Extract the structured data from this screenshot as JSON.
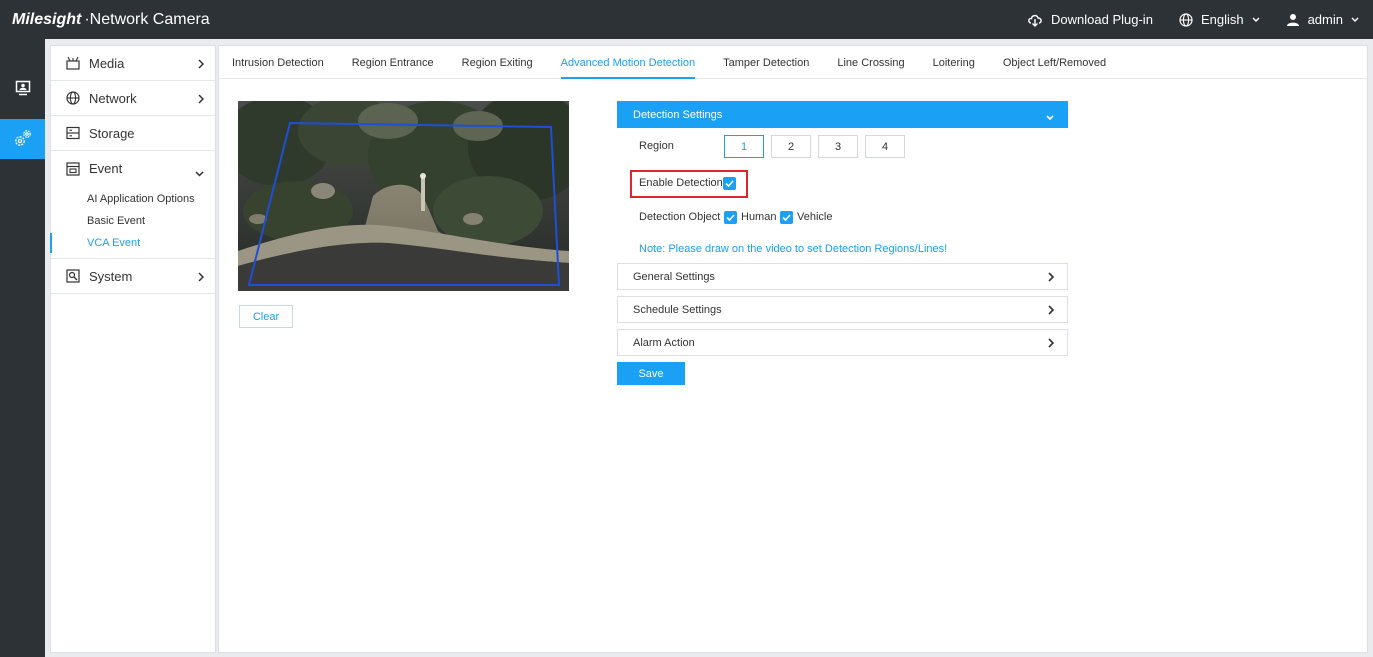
{
  "header": {
    "brand": "Milesight",
    "product": "·Network Camera",
    "download_label": "Download Plug-in",
    "language_label": "English",
    "user_label": "admin"
  },
  "sidebar": {
    "items": [
      {
        "label": "Media"
      },
      {
        "label": "Network"
      },
      {
        "label": "Storage"
      },
      {
        "label": "Event"
      },
      {
        "label": "System"
      }
    ],
    "event_sub": [
      "AI Application Options",
      "Basic Event",
      "VCA Event"
    ]
  },
  "tabs": [
    "Intrusion Detection",
    "Region Entrance",
    "Region Exiting",
    "Advanced Motion Detection",
    "Tamper Detection",
    "Line Crossing",
    "Loitering",
    "Object Left/Removed"
  ],
  "video": {
    "clear_label": "Clear"
  },
  "detection_settings": {
    "title": "Detection Settings",
    "region_label": "Region",
    "regions": [
      "1",
      "2",
      "3",
      "4"
    ],
    "enable_label": "Enable Detection",
    "object_label": "Detection Object",
    "object_human": "Human",
    "object_vehicle": "Vehicle",
    "note": "Note: Please draw on the video to set Detection Regions/Lines!"
  },
  "sections": [
    "General Settings",
    "Schedule Settings",
    "Alarm Action"
  ],
  "save_label": "Save",
  "colors": {
    "accent": "#1aa0f5",
    "topbar": "#2d3236",
    "highlight": "#e0262d"
  }
}
